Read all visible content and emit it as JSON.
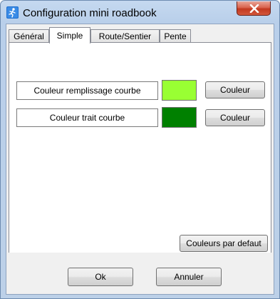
{
  "window": {
    "title": "Configuration  mini roadbook",
    "icon": "runner-app-icon",
    "close_icon": "close-icon"
  },
  "tabs": [
    {
      "label": "Général",
      "active": false
    },
    {
      "label": "Simple",
      "active": true
    },
    {
      "label": "Route/Sentier",
      "active": false
    },
    {
      "label": "Pente",
      "active": false
    }
  ],
  "simple": {
    "fill": {
      "label": "Couleur remplissage courbe",
      "color": "#99ff33",
      "button": "Couleur"
    },
    "stroke": {
      "label": "Couleur trait courbe",
      "color": "#008000",
      "button": "Couleur"
    },
    "defaults_button": "Couleurs par defaut"
  },
  "footer": {
    "ok": "Ok",
    "cancel": "Annuler"
  }
}
